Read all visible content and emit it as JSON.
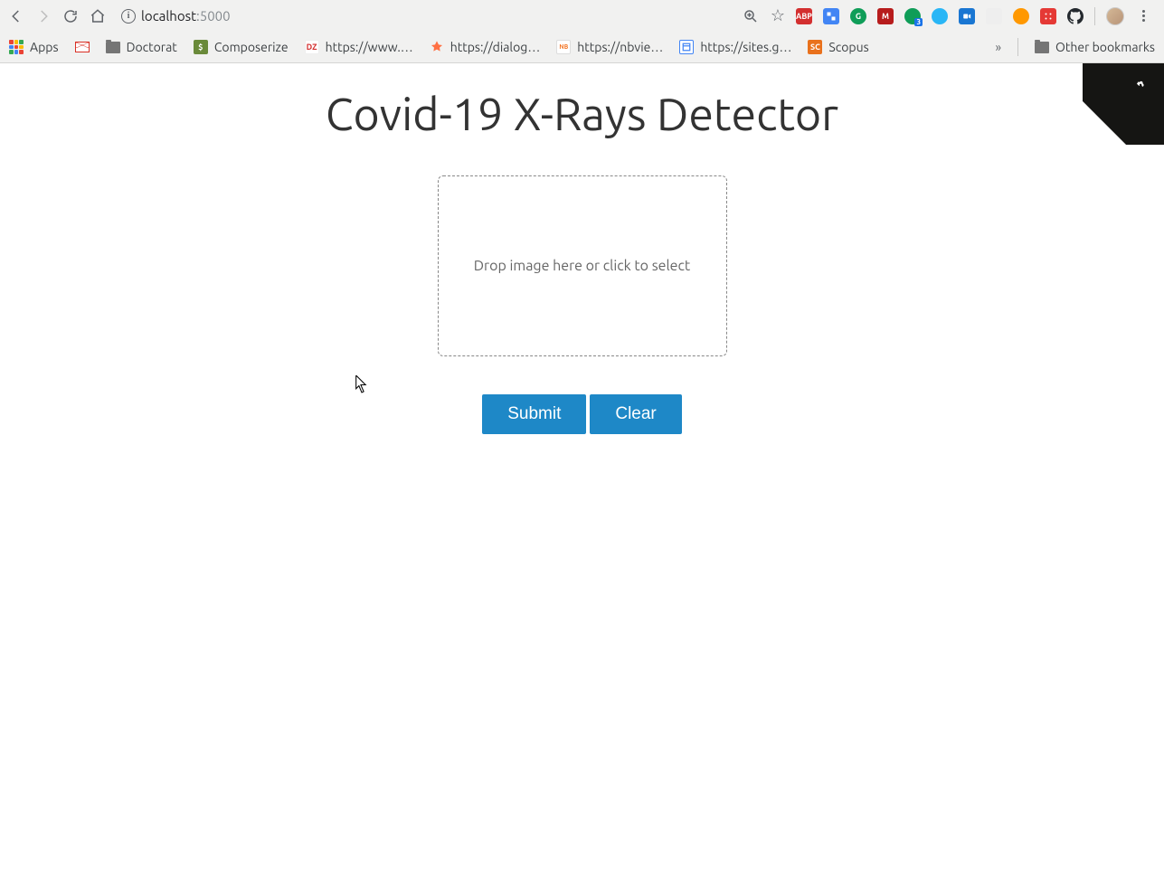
{
  "browser": {
    "url_host": "localhost",
    "url_port": ":5000",
    "bookmarks": {
      "apps": "Apps",
      "doctorat": "Doctorat",
      "composerize": "Composerize",
      "dz": "https://www.…",
      "dialog": "https://dialog…",
      "nbvie": "https://nbvie…",
      "sites": "https://sites.g…",
      "scopus": "Scopus",
      "overflow": "»",
      "other": "Other bookmarks"
    }
  },
  "page": {
    "title": "Covid-19 X-Rays Detector",
    "dropzone_text": "Drop image here or click to select",
    "submit_label": "Submit",
    "clear_label": "Clear"
  }
}
